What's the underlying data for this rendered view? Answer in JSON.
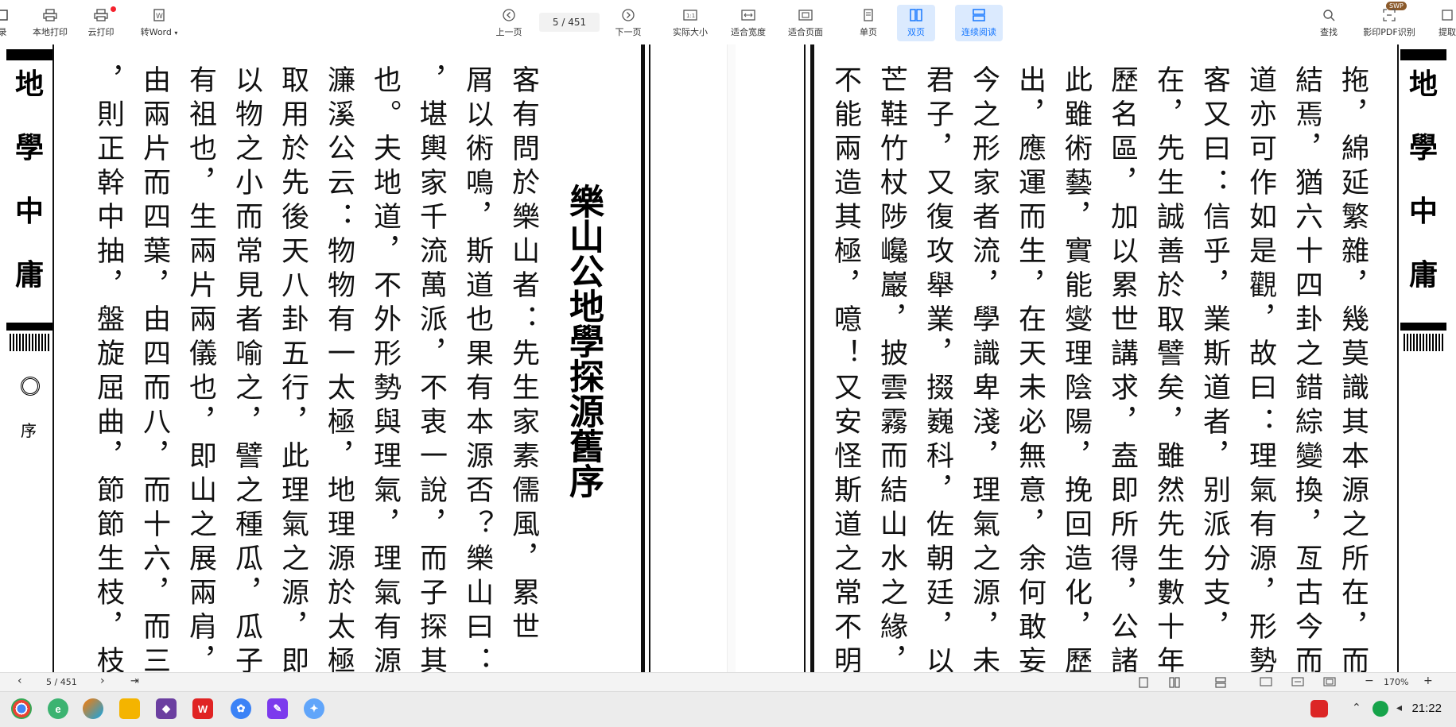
{
  "toolbar": {
    "left_items": [
      {
        "label": "录"
      },
      {
        "label": "本地打印"
      },
      {
        "label": "云打印"
      },
      {
        "label": "转Word"
      }
    ],
    "prev_label": "上一页",
    "page_display": "5 / 451",
    "next_label": "下一页",
    "actual_size": "实际大小",
    "fit_width": "适合宽度",
    "fit_page": "适合页面",
    "single_page": "单页",
    "double_page": "双页",
    "continuous": "连续阅读",
    "search": "查找",
    "ocr": "影印PDF识别",
    "extract": "提取",
    "swp_badge": "SWP"
  },
  "document": {
    "left_page": {
      "band_title": "地學中庸",
      "band_chars": [
        "地",
        "學",
        "中",
        "庸"
      ],
      "band_section": "序",
      "title": "樂山公地學探源舊序",
      "columns": [
        "客有問於樂山者：先生家素儒風，累世",
        "屑以術鳴，斯道也果有本源否？樂山曰：",
        "，堪輿家千流萬派，不衷一說，而子探其",
        "也。夫地道，不外形勢與理氣，理氣有源",
        "濂溪公云：物物有一太極，地理源於太極",
        "取用於先後天八卦五行，此理氣之源，即",
        "以物之小而常見者喻之，譬之種瓜，瓜子",
        "有祖也，生兩片兩儀也，即山之展兩肩，",
        "由兩片而四葉，由四而八，而十六，而三",
        "，則正幹中抽，盤旋屈曲，節節生枝，枝"
      ]
    },
    "right_page": {
      "band_title": "地學中庸",
      "band_chars": [
        "地",
        "學",
        "中",
        "庸"
      ],
      "columns": [
        "拖，綿延繁雜，幾莫識其本源之所在，而",
        "結焉，猶六十四卦之錯綜變換，亙古今而",
        "道亦可作如是觀，故曰：理氣有源，形勢",
        "客又曰：信乎，業斯道者，别派分支，",
        "在，先生誠善於取譬矣，雖然先生數十年",
        "歷名區，加以累世講求，盍即所得，公諸",
        "此雖術藝，實能燮理陰陽，挽回造化，歷",
        "出，應運而生，在天未必無意，余何敢妄",
        "今之形家者流，學識卑淺，理氣之源，未",
        "君子，又復攻舉業，掇巍科，佐朝廷，以",
        "芒鞋竹杖陟巉巖，披雲霧而結山水之緣，",
        "不能兩造其極，噫！又安怪斯道之常不明"
      ]
    }
  },
  "status_bar": {
    "page_display": "5 / 451",
    "zoom": "170%",
    "zoom_minus": "−",
    "zoom_plus": "+"
  },
  "taskbar": {
    "time": "21:22",
    "apps": [
      "chrome-icon",
      "edge-icon",
      "browser-icon",
      "folder-icon",
      "obsidian-icon",
      "wps-icon",
      "cloud-icon",
      "notes-icon",
      "network-icon"
    ]
  },
  "colors": {
    "accent": "#1677ff",
    "active_bg": "#dbeafe",
    "ink": "#111111"
  }
}
